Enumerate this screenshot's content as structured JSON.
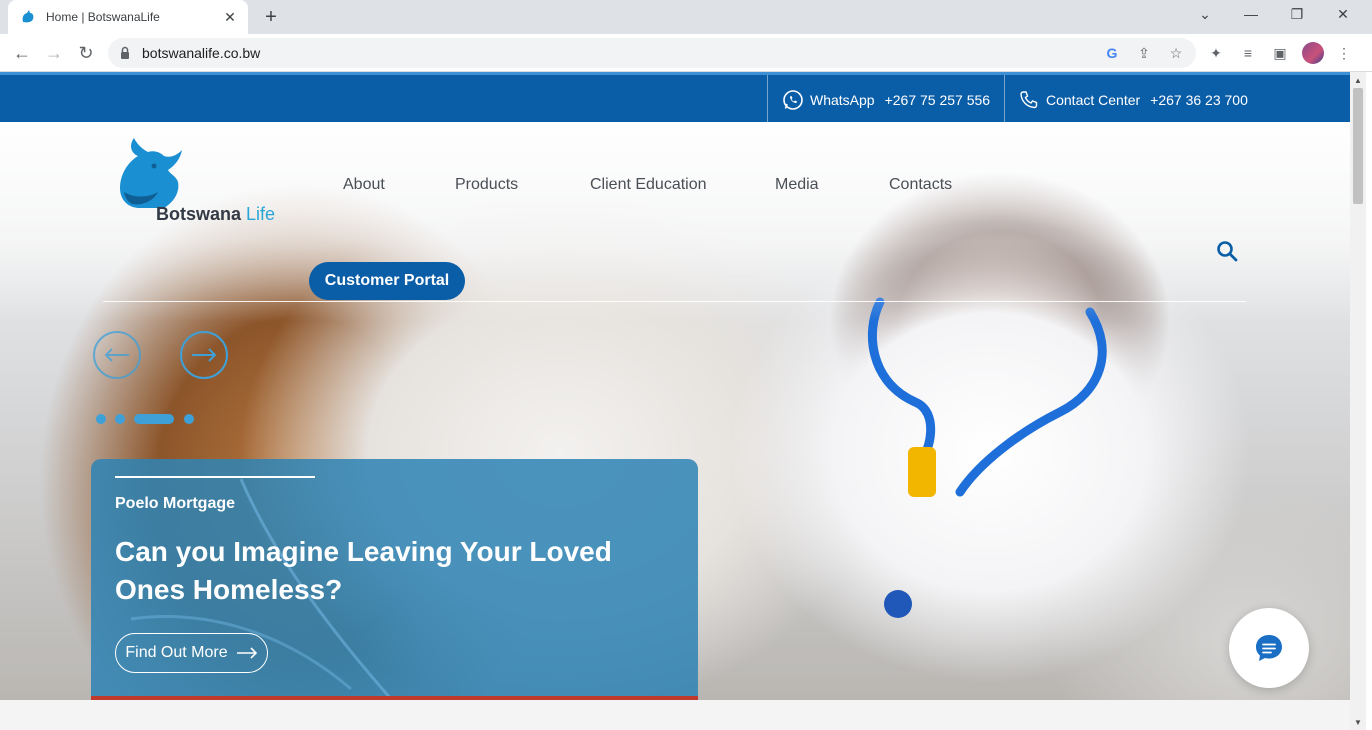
{
  "browser": {
    "tab_title": "Home | BotswanaLife",
    "url": "botswanalife.co.bw"
  },
  "topbar": {
    "whatsapp_label": "WhatsApp",
    "whatsapp_number": "+267 75 257 556",
    "contact_label": "Contact Center",
    "contact_number": "+267 36 23 700"
  },
  "header": {
    "logo_brand": "Botswana",
    "logo_suffix": "Life",
    "nav": [
      "About",
      "Products",
      "Client Education",
      "Media",
      "Contacts"
    ],
    "portal_button": "Customer Portal"
  },
  "slider": {
    "total_slides": 4,
    "active_slide": 3,
    "caption": {
      "kicker": "Poelo Mortgage",
      "headline": "Can you Imagine Leaving Your Loved Ones Homeless?",
      "button": "Find Out More"
    }
  },
  "colors": {
    "brand_blue": "#0a5ea8",
    "accent_blue": "#3fa0d8",
    "caption_bg": "#2e84b4",
    "caption_accent": "#c0392b"
  },
  "icons": [
    "whatsapp-icon",
    "phone-icon",
    "search-icon",
    "arrow-left-icon",
    "arrow-right-icon",
    "chat-icon"
  ]
}
